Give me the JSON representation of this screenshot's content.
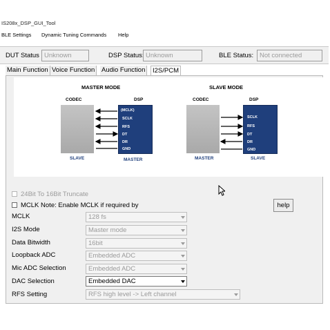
{
  "window": {
    "title": "IS208x_DSP_GUI_Tool"
  },
  "menu": {
    "items": [
      "BLE Settings",
      "Dynamic Tuning Commands",
      "Help"
    ]
  },
  "status": {
    "dut_label": "DUT Status",
    "dut_value": "Unknown",
    "dsp_label": "DSP Status:",
    "dsp_value": "Unknown",
    "ble_label": "BLE Status:",
    "ble_value": "Not connected"
  },
  "tabs": [
    {
      "label": "Main Function",
      "active": false
    },
    {
      "label": "Voice Function",
      "active": false
    },
    {
      "label": "Audio Function",
      "active": false
    },
    {
      "label": "I2S/PCM",
      "active": true
    }
  ],
  "diagram": {
    "master": {
      "title": "MASTER MODE",
      "codec_label": "CODEC",
      "dsp_label": "DSP",
      "codec_role": "SLAVE",
      "dsp_role": "MASTER",
      "signals": [
        "(MCLK)",
        "SCLK",
        "RFS",
        "DT",
        "DR",
        "GND"
      ]
    },
    "slave": {
      "title": "SLAVE MODE",
      "codec_label": "CODEC",
      "dsp_label": "DSP",
      "codec_role": "MASTER",
      "dsp_role": "SLAVE",
      "signals": [
        "SCLK",
        "RFS",
        "DT",
        "DR",
        "GND"
      ]
    }
  },
  "options": {
    "truncate_label": "24Bit To 16Bit Truncate",
    "mclk_label": "MCLK  Note: Enable MCLK if required by",
    "help_label": "help"
  },
  "fields": [
    {
      "label": "MCLK",
      "value": "128 fs",
      "enabled": false
    },
    {
      "label": "I2S Mode",
      "value": "Master mode",
      "enabled": false
    },
    {
      "label": "Data Bitwidth",
      "value": "16bit",
      "enabled": false
    },
    {
      "label": "Loopback ADC",
      "value": "Embedded ADC",
      "enabled": false
    },
    {
      "label": "Mic ADC Selection",
      "value": "Embedded ADC",
      "enabled": false
    },
    {
      "label": "DAC Selection",
      "value": "Embedded DAC",
      "enabled": true
    },
    {
      "label": "RFS Setting",
      "value": "RFS high level -> Left channel",
      "enabled": false
    }
  ],
  "colors": {
    "dsp_block": "#1f3f7c",
    "codec_block": "#b3b3b3",
    "disabled_text": "#9a9a9a"
  }
}
